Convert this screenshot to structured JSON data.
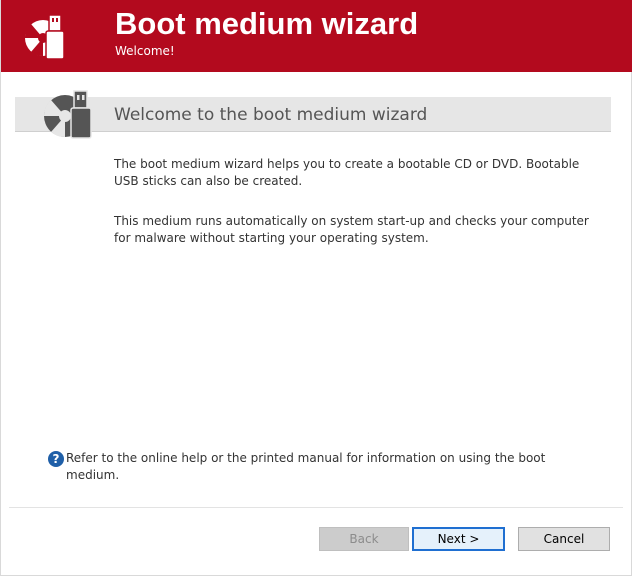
{
  "header": {
    "title": "Boot medium wizard",
    "subtitle": "Welcome!",
    "brand_color": "#b30a1e"
  },
  "welcome": {
    "heading": "Welcome to the boot medium wizard"
  },
  "body": {
    "paragraph1": "The boot medium wizard helps you to create a bootable CD or DVD. Bootable USB sticks can also be created.",
    "paragraph2": "This medium runs automatically on system start-up and checks your computer for malware without starting your operating system."
  },
  "help": {
    "icon": "question-mark-icon",
    "text": "Refer to the online help or the printed manual for information on using the boot medium."
  },
  "buttons": {
    "back": "Back",
    "next": "Next >",
    "cancel": "Cancel"
  },
  "icons": {
    "header": "cd-usb-icon",
    "welcome": "cd-usb-icon"
  }
}
